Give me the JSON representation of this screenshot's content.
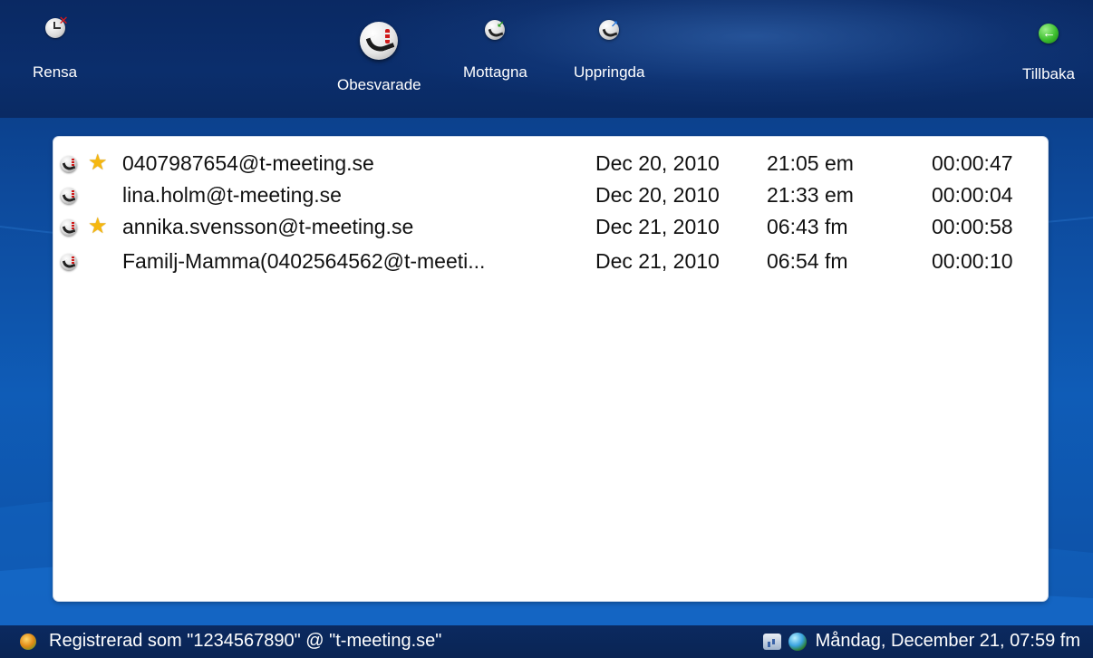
{
  "toolbar": {
    "clear_label": "Rensa",
    "missed_label": "Obesvarade",
    "received_label": "Mottagna",
    "dialed_label": "Uppringda",
    "back_label": "Tillbaka"
  },
  "calls": [
    {
      "contact": "0407987654@t-meeting.se",
      "favorite": true,
      "date": "Dec 20, 2010",
      "time": "21:05 em",
      "duration": "00:00:47"
    },
    {
      "contact": "lina.holm@t-meeting.se",
      "favorite": false,
      "date": "Dec 20, 2010",
      "time": "21:33 em",
      "duration": "00:00:04"
    },
    {
      "contact": "annika.svensson@t-meeting.se",
      "favorite": true,
      "date": "Dec 21, 2010",
      "time": "06:43 fm",
      "duration": "00:00:58"
    },
    {
      "contact": "Familj-Mamma(0402564562@t-meeti...",
      "favorite": false,
      "date": "Dec 21, 2010",
      "time": "06:54 fm",
      "duration": "00:00:10"
    }
  ],
  "status": {
    "registration": "Registrerad som \"1234567890\" @ \"t-meeting.se\"",
    "datetime": "Måndag, December 21, 07:59 fm"
  },
  "colors": {
    "accent_star": "#f5b70f",
    "missed_red": "#d01a1a",
    "header_bg": "#0a2963"
  }
}
